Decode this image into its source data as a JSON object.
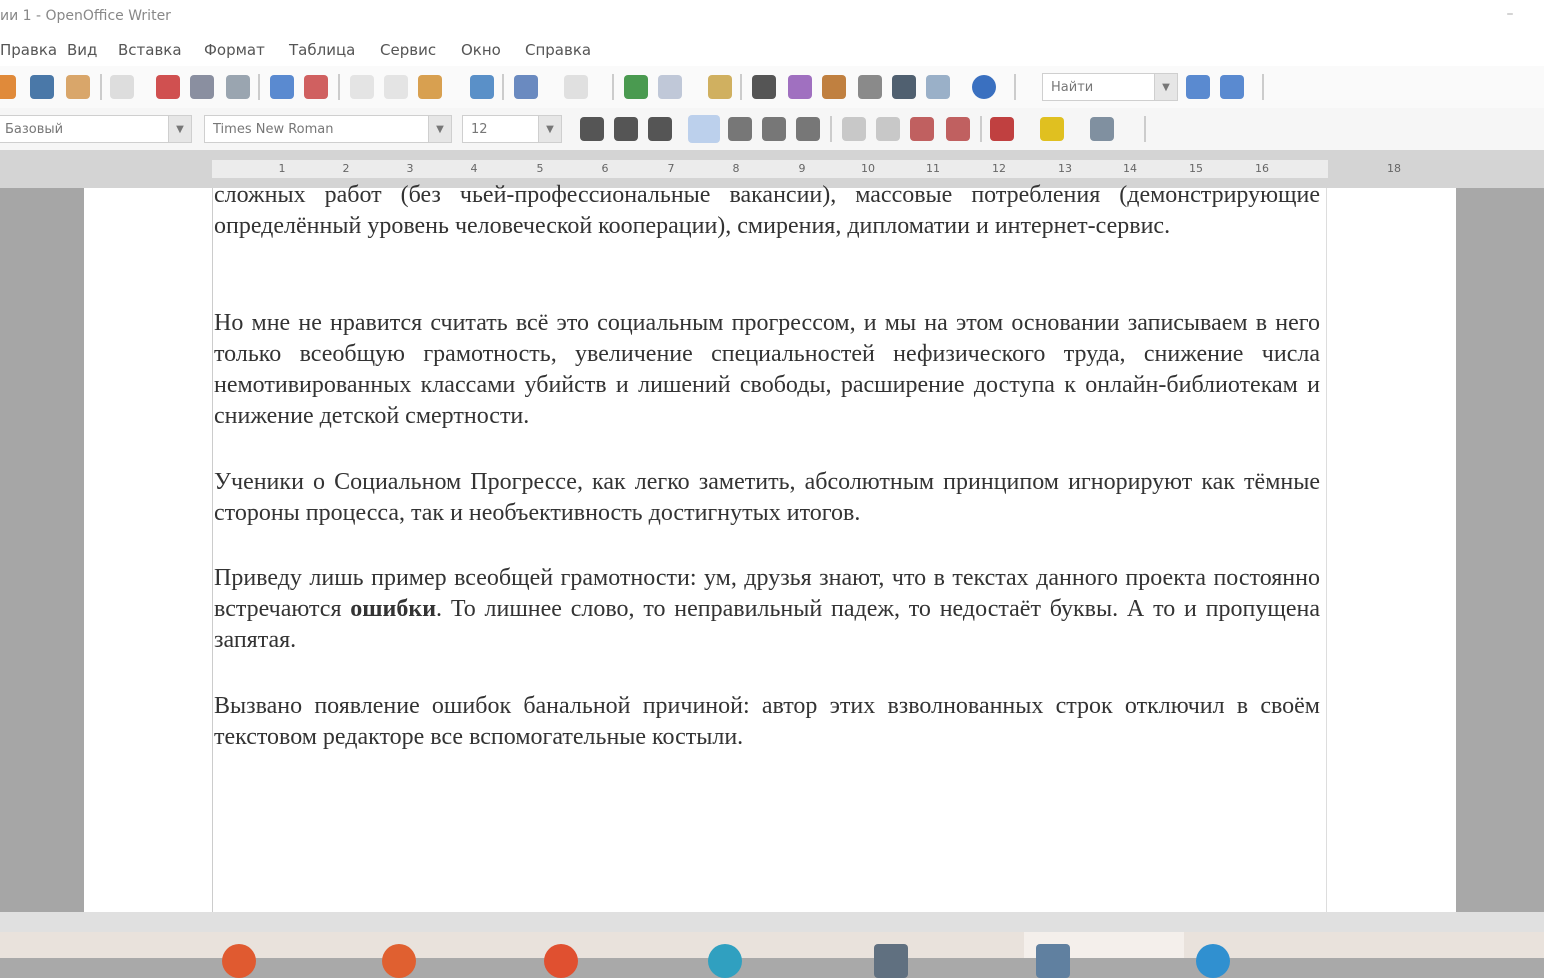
{
  "window": {
    "title": "ии 1 - OpenOffice Writer"
  },
  "menu": [
    "Правка",
    "Вид",
    "Вставка",
    "Формат",
    "Таблица",
    "Сервис",
    "Окно",
    "Справка"
  ],
  "toolbar_standard": {
    "find_placeholder": "Найти"
  },
  "toolbar_format": {
    "style": "Базовый",
    "font": "Times New Roman",
    "size": "12"
  },
  "ruler": {
    "numbers": [
      "1",
      "2",
      "3",
      "4",
      "5",
      "6",
      "7",
      "8",
      "9",
      "10",
      "11",
      "12",
      "13",
      "14",
      "15",
      "16",
      "18"
    ]
  },
  "document": {
    "p0": "сложных работ (без чьей-профессиональные вакансии), массовые потребления (демонстрирующие определённый уровень человеческой кооперации), смирения, дипломатии и интернет-сервис.",
    "p1": "Но мне не нравится считать всё это социальным прогрессом, и мы на этом основании записываем в него только всеобщую грамотность, увеличение специальностей нефизического труда, снижение числа немотивированных классами убийств и лишений свободы, расширение доступа к онлайн-библиотекам и снижение детской смертности.",
    "p2": "Ученики о Социальном Прогрессе, как легко заметить, абсолютным принципом игнорируют как тёмные стороны процесса, так и необъективность достигнутых итогов.",
    "p3_before": "Приведу лишь пример всеобщей грамотности: ум, друзья знают, что в текстах данного проекта постоянно встречаются ",
    "p3_bold": "ошибки",
    "p3_after": ". То лишнее слово, то неправильный падеж, то недостаёт буквы. А то и пропущена запятая.",
    "p4": "Вызвано появление ошибок банальной причиной: автор этих взволнованных строк отключил в своём текстовом редакторе все вспомогательные костыли."
  }
}
